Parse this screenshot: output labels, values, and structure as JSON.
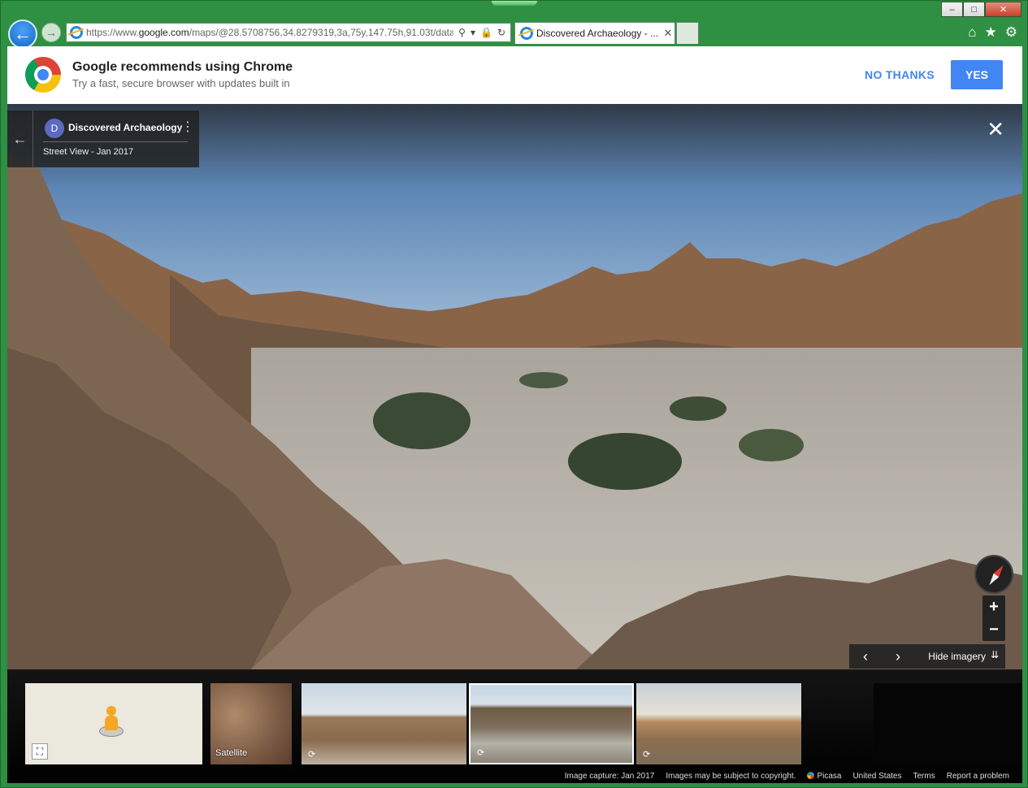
{
  "browser": {
    "url_prefix": "https://www.",
    "url_domain": "google.com",
    "url_path": "/maps/@28.5708756,34.8279319,3a,75y,147.75h,91.03t/data=!",
    "tab_title": "Discovered Archaeology - ...",
    "window_buttons": {
      "minimize": "‒",
      "maximize": "□",
      "close": "✕"
    }
  },
  "chrome_banner": {
    "title": "Google recommends using Chrome",
    "subtitle": "Try a fast, secure browser with updates built in",
    "no_thanks_label": "NO THANKS",
    "yes_label": "YES"
  },
  "info_card": {
    "avatar_letter": "D",
    "title": "Discovered Archaeology",
    "subtitle": "Street View - Jan 2017"
  },
  "controls": {
    "zoom_in": "+",
    "zoom_out": "−",
    "hide_imagery_label": "Hide imagery"
  },
  "filmstrip": {
    "satellite_label": "Satellite"
  },
  "footer": {
    "capture": "Image capture: Jan 2017",
    "copyright": "Images may be subject to copyright.",
    "picasa": "Picasa",
    "region": "United States",
    "terms": "Terms",
    "report": "Report a problem"
  },
  "colors": {
    "accent_blue": "#4285f4",
    "window_frame": "#2f8f43"
  }
}
